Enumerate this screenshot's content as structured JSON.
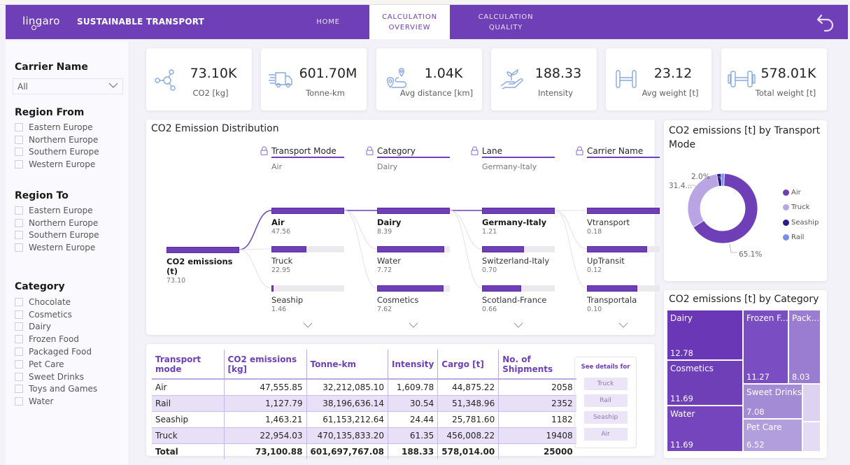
{
  "header": {
    "logo": "lingaro",
    "app_title": "SUSTAINABLE TRANSPORT",
    "tabs": [
      {
        "line1": "HOME",
        "line2": "",
        "active": false
      },
      {
        "line1": "CALCULATION",
        "line2": "OVERVIEW",
        "active": true
      },
      {
        "line1": "CALCULATION",
        "line2": "QUALITY",
        "active": false
      }
    ],
    "back_icon": "undo-arrow-icon"
  },
  "sidebar": {
    "carrier": {
      "title": "Carrier Name",
      "value": "All"
    },
    "region_from": {
      "title": "Region From",
      "items": [
        "Eastern Europe",
        "Northern Europe",
        "Southern Europe",
        "Western Europe"
      ]
    },
    "region_to": {
      "title": "Region To",
      "items": [
        "Eastern Europe",
        "Northern Europe",
        "Southern Europe",
        "Western Europe"
      ]
    },
    "category": {
      "title": "Category",
      "items": [
        "Chocolate",
        "Cosmetics",
        "Dairy",
        "Frozen Food",
        "Packaged Food",
        "Pet Care",
        "Sweet Drinks",
        "Toys and Games",
        "Water"
      ]
    }
  },
  "kpis": [
    {
      "value": "73.10K",
      "label": "CO2 [kg]",
      "icon": "molecule-icon"
    },
    {
      "value": "601.70M",
      "label": "Tonne-km",
      "icon": "delivery-truck-icon"
    },
    {
      "value": "1.04K",
      "label": "Avg distance [km]",
      "icon": "route-pin-icon"
    },
    {
      "value": "188.33",
      "label": "Intensity",
      "icon": "plant-in-hand-icon"
    },
    {
      "value": "23.12",
      "label": "Avg weight [t]",
      "icon": "dumbbell-icon"
    },
    {
      "value": "578.01K",
      "label": "Total weight [t]",
      "icon": "heavy-dumbbell-icon"
    }
  ],
  "decomposition": {
    "title": "CO2 Emission Distribution",
    "root": {
      "name": "CO2 emissions (t)",
      "value": "73.10"
    },
    "levels": [
      {
        "header": "Transport Mode",
        "selected": "Air",
        "nodes": [
          {
            "name": "Air",
            "value": "47.56",
            "fraction": 1.0,
            "bold": true
          },
          {
            "name": "Truck",
            "value": "22.95",
            "fraction": 0.48
          },
          {
            "name": "Seaship",
            "value": "1.46",
            "fraction": 0.03
          }
        ]
      },
      {
        "header": "Category",
        "selected": "Dairy",
        "nodes": [
          {
            "name": "Dairy",
            "value": "8.39",
            "fraction": 1.0,
            "bold": true
          },
          {
            "name": "Water",
            "value": "7.72",
            "fraction": 0.92
          },
          {
            "name": "Cosmetics",
            "value": "7.62",
            "fraction": 0.91
          }
        ]
      },
      {
        "header": "Lane",
        "selected": "Germany-Italy",
        "nodes": [
          {
            "name": "Germany-Italy",
            "value": "1.21",
            "fraction": 1.0,
            "bold": true
          },
          {
            "name": "Switzerland-Italy",
            "value": "0.70",
            "fraction": 0.58
          },
          {
            "name": "Scotland-France",
            "value": "0.66",
            "fraction": 0.54
          }
        ]
      },
      {
        "header": "Carrier Name",
        "selected": "",
        "nodes": [
          {
            "name": "Vtransport",
            "value": "0.18",
            "fraction": 1.0
          },
          {
            "name": "UpTransit",
            "value": "0.12",
            "fraction": 0.83
          },
          {
            "name": "Transportala",
            "value": "0.10",
            "fraction": 0.69
          }
        ]
      }
    ]
  },
  "table": {
    "columns": [
      "Transport mode",
      "CO2 emissions [kg]",
      "Tonne-km",
      "Intensity",
      "Cargo [t]",
      "No. of Shipments"
    ],
    "rows": [
      [
        "Air",
        "47,555.85",
        "32,212,085.10",
        "1,609.78",
        "44,875.22",
        "2058"
      ],
      [
        "Rail",
        "1,127.79",
        "38,196,636.14",
        "30.54",
        "51,348.96",
        "2352"
      ],
      [
        "Seaship",
        "1,463.21",
        "61,153,212.64",
        "24.44",
        "25,781.60",
        "1182"
      ],
      [
        "Truck",
        "22,954.03",
        "470,135,833.20",
        "61.35",
        "456,008.22",
        "19408"
      ]
    ],
    "total": [
      "Total",
      "73,100.88",
      "601,697,767.08",
      "188.33",
      "578,014.00",
      "25000"
    ]
  },
  "details": {
    "title": "See details for",
    "buttons": [
      "Truck",
      "Rail",
      "Seaship",
      "Air"
    ]
  },
  "chart_data": [
    {
      "type": "pie",
      "title": "CO2 emissions [t] by Transport Mode",
      "categories": [
        "Air",
        "Truck",
        "Seaship",
        "Rail"
      ],
      "values": [
        65.1,
        31.4,
        2.0,
        1.5
      ],
      "data_labels": [
        "65.1%",
        "31.4...",
        "2.0%",
        ""
      ],
      "colors": [
        "#6f3fb8",
        "#b9a5e3",
        "#2a1a8c",
        "#7b8ee8"
      ],
      "legend": "right"
    },
    {
      "type": "heatmap",
      "subtype": "treemap",
      "title": "CO2 emissions [t] by Category",
      "categories": [
        "Dairy",
        "Cosmetics",
        "Water",
        "Frozen F...",
        "Pack...",
        "Sweet Drinks",
        "Pet Care",
        "",
        ""
      ],
      "values": [
        12.78,
        11.69,
        11.69,
        11.27,
        8.03,
        7.08,
        6.52,
        null,
        null
      ]
    }
  ]
}
